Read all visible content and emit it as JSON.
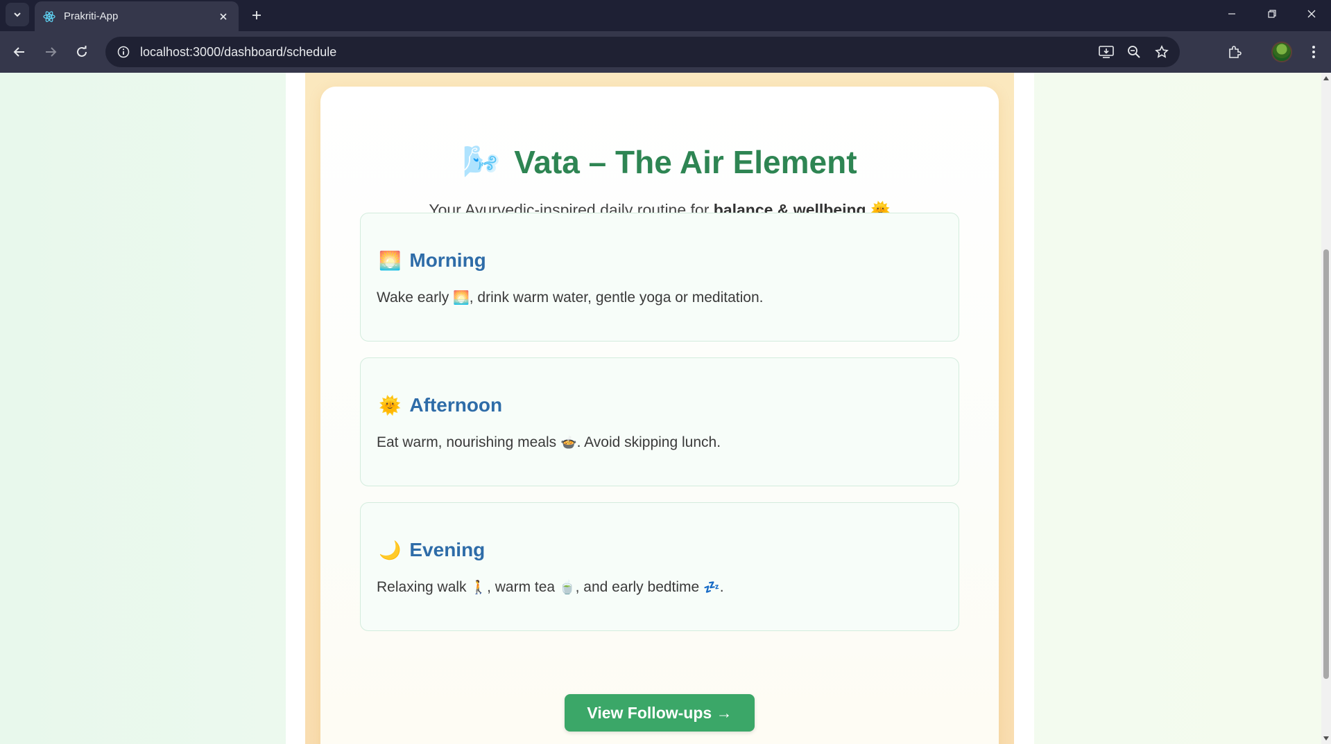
{
  "browser": {
    "tab_title": "Prakriti-App",
    "url": "localhost:3000/dashboard/schedule",
    "icons": {
      "tab_list": "chevron-down-icon",
      "favicon": "react-icon",
      "tab_close": "close-icon",
      "new_tab": "plus-icon",
      "back": "arrow-left-icon",
      "forward": "arrow-right-icon",
      "reload": "reload-icon",
      "site_info": "info-icon",
      "install": "install-icon",
      "zoom": "zoom-icon",
      "bookmark": "star-icon",
      "extensions": "puzzle-icon",
      "menu": "kebab-icon"
    }
  },
  "page": {
    "title_emoji": "🌬️",
    "title": "Vata – The Air Element",
    "subtitle_prefix": "Your Ayurvedic-inspired daily routine for ",
    "subtitle_bold": "balance & wellbeing",
    "subtitle_emoji": "🌞",
    "sections": [
      {
        "emoji": "🌅",
        "title": "Morning",
        "body_parts": [
          "Wake early ",
          "🌅",
          ", drink warm water, gentle yoga or meditation."
        ]
      },
      {
        "emoji": "🌞",
        "title": "Afternoon",
        "body_parts": [
          "Eat warm, nourishing meals ",
          "🍲",
          ". Avoid skipping lunch."
        ]
      },
      {
        "emoji": "🌙",
        "title": "Evening",
        "body_parts": [
          "Relaxing walk ",
          "🚶",
          ", warm tea ",
          "🍵",
          ", and early bedtime ",
          "💤",
          "."
        ]
      }
    ],
    "cta_label": "View Follow-ups →"
  },
  "colors": {
    "title": "#2e8553",
    "section_title": "#2e6ca8",
    "cta": "#3ba768",
    "chrome": "#35374b"
  }
}
